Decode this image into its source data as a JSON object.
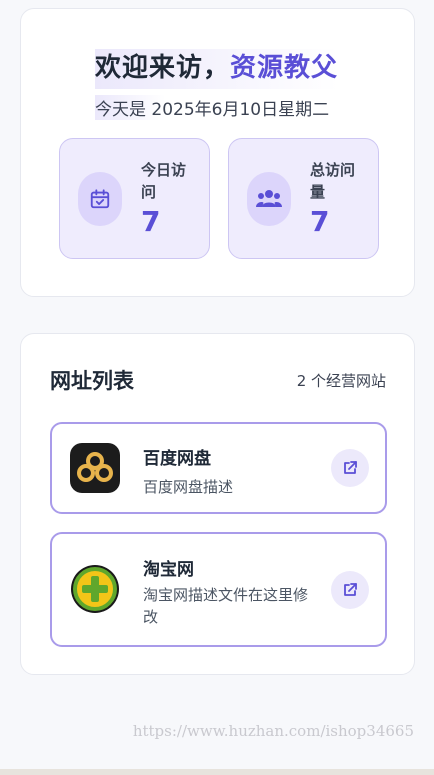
{
  "welcome": {
    "greeting": "欢迎来访，",
    "name": "资源教父",
    "date": "今天是 2025年6月10日星期二"
  },
  "stats": {
    "today": {
      "label": "今日访问",
      "value": "7",
      "icon": "calendar-check-icon"
    },
    "total": {
      "label": "总访问量",
      "value": "7",
      "icon": "users-icon"
    }
  },
  "site_list": {
    "title": "网址列表",
    "count": "2 个经营网站",
    "items": [
      {
        "name": "百度网盘",
        "description": "百度网盘描述",
        "icon": "baidu-netdisk-logo",
        "action_icon": "external-link-icon"
      },
      {
        "name": "淘宝网",
        "description": "淘宝网描述文件在这里修改",
        "icon": "taobao-logo",
        "action_icon": "external-link-icon"
      }
    ]
  },
  "watermark": "https://www.huzhan.com/ishop34665",
  "colors": {
    "accent": "#5a4fd6",
    "card_border": "#a99bea",
    "stat_bg": "#efecfd"
  }
}
